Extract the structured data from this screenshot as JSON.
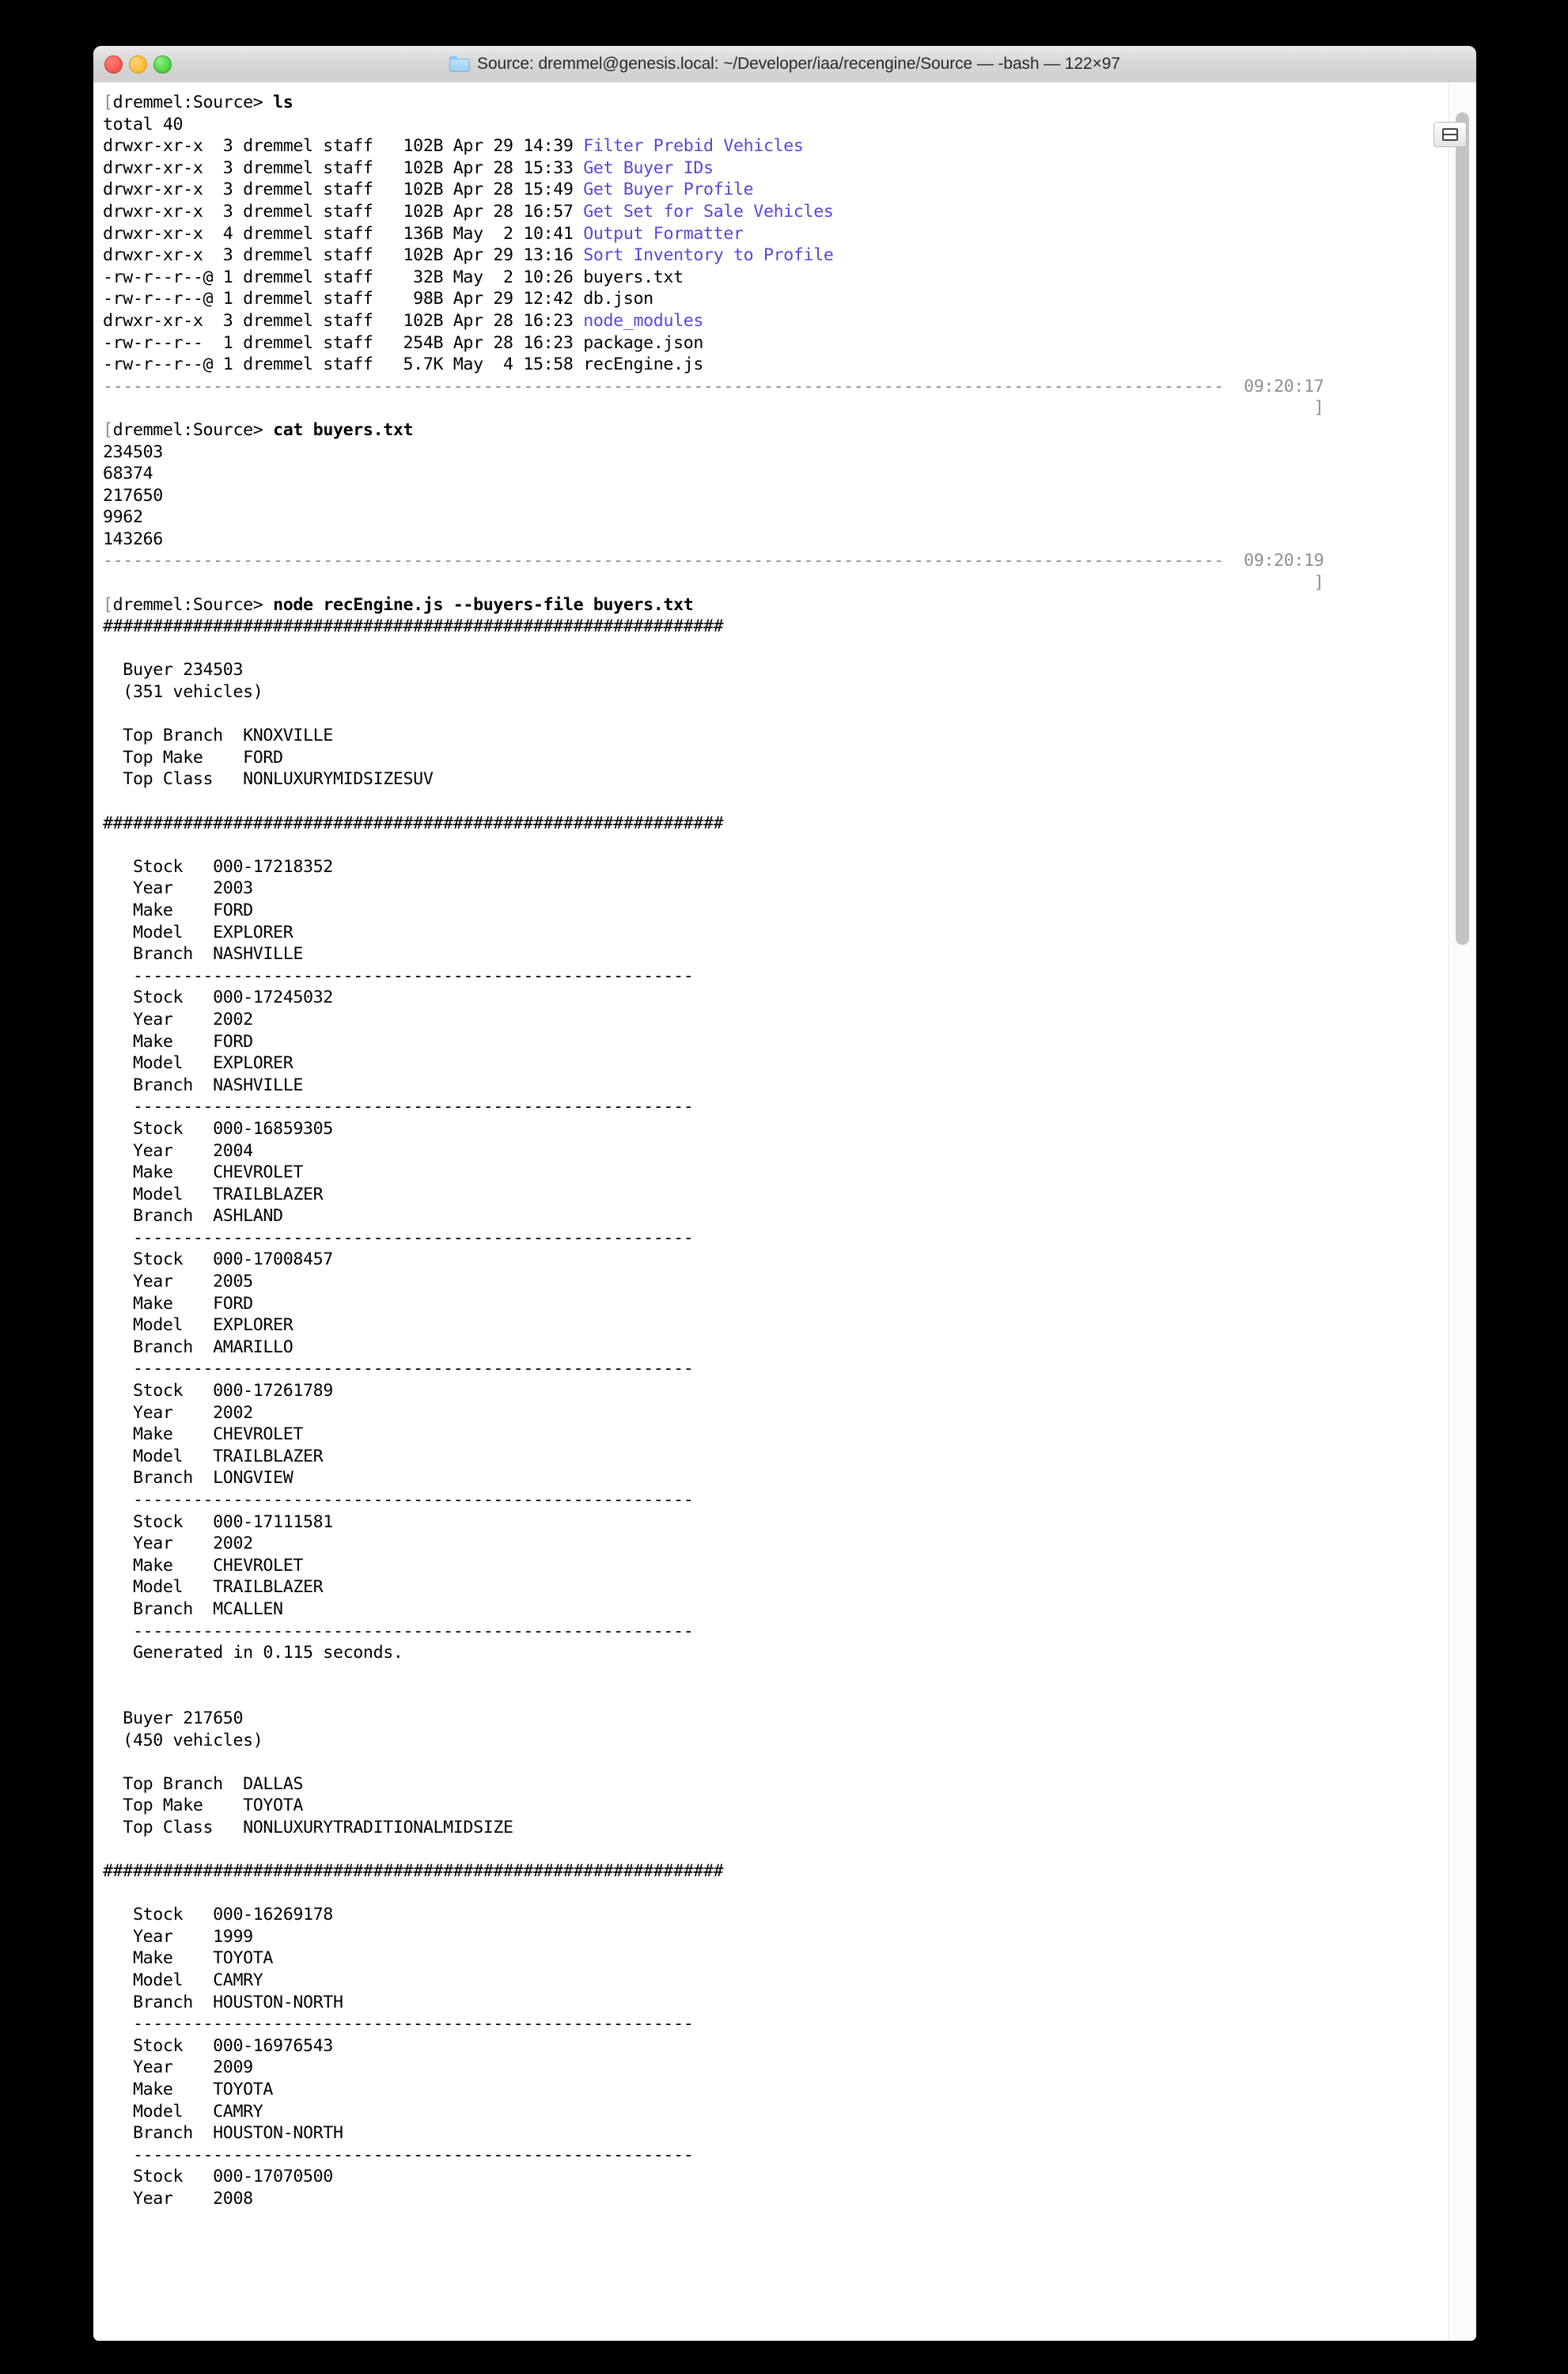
{
  "window": {
    "title": "Source: dremmel@genesis.local: ~/Developer/iaa/recengine/Source — -bash — 122×97",
    "folder_icon": "folder-icon",
    "traffic_lights": [
      "close",
      "minimize",
      "maximize"
    ],
    "split_pane_icon": "split-pane-icon",
    "columns": 122,
    "rows": 97
  },
  "terminal": {
    "prompt": "dremmel:Source>",
    "commands": [
      {
        "text": "ls"
      },
      {
        "text": "cat buyers.txt"
      },
      {
        "text": "node recEngine.js --buyers-file buyers.txt"
      }
    ],
    "timestamps": [
      "09:20:17",
      "09:20:19"
    ],
    "ls": {
      "total_line": "total 40",
      "entries": [
        {
          "perms": "drwxr-xr-x",
          "links": "3",
          "owner": "dremmel",
          "group": "staff",
          "size": "102B",
          "month": "Apr",
          "day": "29",
          "time": "14:39",
          "name": "Filter Prebid Vehicles",
          "is_dir": true
        },
        {
          "perms": "drwxr-xr-x",
          "links": "3",
          "owner": "dremmel",
          "group": "staff",
          "size": "102B",
          "month": "Apr",
          "day": "28",
          "time": "15:33",
          "name": "Get Buyer IDs",
          "is_dir": true
        },
        {
          "perms": "drwxr-xr-x",
          "links": "3",
          "owner": "dremmel",
          "group": "staff",
          "size": "102B",
          "month": "Apr",
          "day": "28",
          "time": "15:49",
          "name": "Get Buyer Profile",
          "is_dir": true
        },
        {
          "perms": "drwxr-xr-x",
          "links": "3",
          "owner": "dremmel",
          "group": "staff",
          "size": "102B",
          "month": "Apr",
          "day": "28",
          "time": "16:57",
          "name": "Get Set for Sale Vehicles",
          "is_dir": true
        },
        {
          "perms": "drwxr-xr-x",
          "links": "4",
          "owner": "dremmel",
          "group": "staff",
          "size": "136B",
          "month": "May",
          "day": " 2",
          "time": "10:41",
          "name": "Output Formatter",
          "is_dir": true
        },
        {
          "perms": "drwxr-xr-x",
          "links": "3",
          "owner": "dremmel",
          "group": "staff",
          "size": "102B",
          "month": "Apr",
          "day": "29",
          "time": "13:16",
          "name": "Sort Inventory to Profile",
          "is_dir": true
        },
        {
          "perms": "-rw-r--r--@",
          "links": "1",
          "owner": "dremmel",
          "group": "staff",
          "size": " 32B",
          "month": "May",
          "day": " 2",
          "time": "10:26",
          "name": "buyers.txt",
          "is_dir": false
        },
        {
          "perms": "-rw-r--r--@",
          "links": "1",
          "owner": "dremmel",
          "group": "staff",
          "size": " 98B",
          "month": "Apr",
          "day": "29",
          "time": "12:42",
          "name": "db.json",
          "is_dir": false
        },
        {
          "perms": "drwxr-xr-x",
          "links": "3",
          "owner": "dremmel",
          "group": "staff",
          "size": "102B",
          "month": "Apr",
          "day": "28",
          "time": "16:23",
          "name": "node_modules",
          "is_dir": true
        },
        {
          "perms": "-rw-r--r-- ",
          "links": "1",
          "owner": "dremmel",
          "group": "staff",
          "size": "254B",
          "month": "Apr",
          "day": "28",
          "time": "16:23",
          "name": "package.json",
          "is_dir": false
        },
        {
          "perms": "-rw-r--r--@",
          "links": "1",
          "owner": "dremmel",
          "group": "staff",
          "size": "5.7K",
          "month": "May",
          "day": " 4",
          "time": "15:58",
          "name": "recEngine.js",
          "is_dir": false
        }
      ]
    },
    "buyers_file_contents": [
      "234503",
      "68374",
      "217650",
      "9962",
      "143266"
    ],
    "report": {
      "hash_rule": "##############################################################",
      "dash_rule": "--------------------------------------------------------",
      "buyers": [
        {
          "id": "234503",
          "vehicle_count_line": "(351 vehicles)",
          "top_branch": "KNOXVILLE",
          "top_make": "FORD",
          "top_class": "NONLUXURYMIDSIZESUV",
          "generated_line": "Generated in 0.115 seconds.",
          "vehicles": [
            {
              "stock": "000-17218352",
              "year": "2003",
              "make": "FORD",
              "model": "EXPLORER",
              "branch": "NASHVILLE"
            },
            {
              "stock": "000-17245032",
              "year": "2002",
              "make": "FORD",
              "model": "EXPLORER",
              "branch": "NASHVILLE"
            },
            {
              "stock": "000-16859305",
              "year": "2004",
              "make": "CHEVROLET",
              "model": "TRAILBLAZER",
              "branch": "ASHLAND"
            },
            {
              "stock": "000-17008457",
              "year": "2005",
              "make": "FORD",
              "model": "EXPLORER",
              "branch": "AMARILLO"
            },
            {
              "stock": "000-17261789",
              "year": "2002",
              "make": "CHEVROLET",
              "model": "TRAILBLAZER",
              "branch": "LONGVIEW"
            },
            {
              "stock": "000-17111581",
              "year": "2002",
              "make": "CHEVROLET",
              "model": "TRAILBLAZER",
              "branch": "MCALLEN"
            }
          ]
        },
        {
          "id": "217650",
          "vehicle_count_line": "(450 vehicles)",
          "top_branch": "DALLAS",
          "top_make": "TOYOTA",
          "top_class": "NONLUXURYTRADITIONALMIDSIZE",
          "generated_line": "",
          "vehicles": [
            {
              "stock": "000-16269178",
              "year": "1999",
              "make": "TOYOTA",
              "model": "CAMRY",
              "branch": "HOUSTON-NORTH"
            },
            {
              "stock": "000-16976543",
              "year": "2009",
              "make": "TOYOTA",
              "model": "CAMRY",
              "branch": "HOUSTON-NORTH"
            },
            {
              "stock": "000-17070500",
              "year": "2008",
              "make": "",
              "model": "",
              "branch": ""
            }
          ]
        }
      ],
      "labels": {
        "stock": "Stock",
        "year": "Year",
        "make": "Make",
        "model": "Model",
        "branch": "Branch",
        "buyer": "Buyer",
        "top_branch": "Top Branch",
        "top_make": "Top Make",
        "top_class": "Top Class"
      }
    },
    "colors": {
      "dir": "#5b45d8",
      "text": "#000000",
      "timestamp": "#8e8e8e",
      "background": "#ffffff"
    }
  }
}
